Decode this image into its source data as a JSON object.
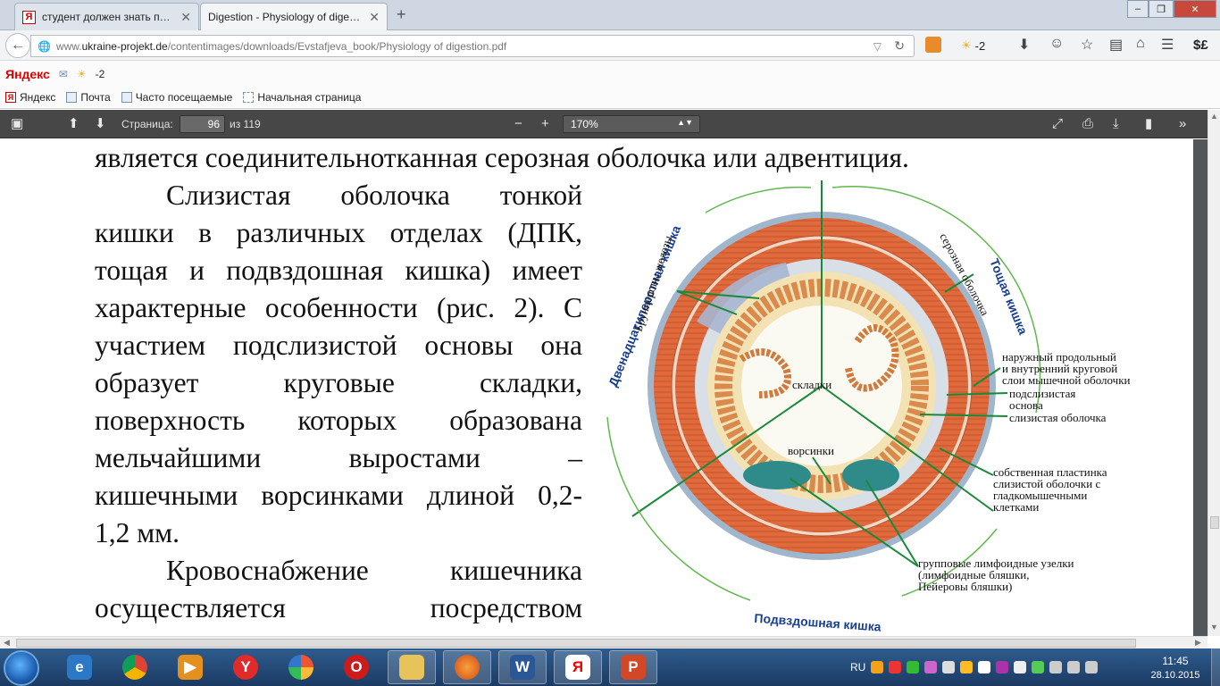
{
  "browser": {
    "tabs": [
      {
        "label": "студент должен знать при...",
        "active": false
      },
      {
        "label": "Digestion - Physiology of diges...",
        "active": true
      }
    ],
    "url_prefix": "www.",
    "url_domain": "ukraine-projekt.de",
    "url_path": "/contentimages/downloads/Evstafjeva_book/Physiology of digestion.pdf",
    "weather_temp": "-2",
    "currency_label": "$£"
  },
  "yandex_bar": {
    "logo": "Яндекс",
    "weather_temp": "-2"
  },
  "bookmarks": [
    "Яндекс",
    "Почта",
    "Часто посещаемые",
    "Начальная страница"
  ],
  "pdf_toolbar": {
    "page_label": "Страница:",
    "page_value": "96",
    "page_total": "из 119",
    "zoom_value": "170%"
  },
  "document": {
    "top_line": "является соединительнотканная серозная оболочка или адвентиция.",
    "lines": [
      "Слизистая оболочка тонкой",
      "кишки в различных отделах (ДПК,",
      "тощая и подвздошная кишка) имеет",
      "характерные особенности (рис. 2). С",
      "участием подслизистой основы она",
      "образует круговые складки,",
      "поверхность которых образована",
      "мельчайшими выростами –",
      "кишечными ворсинками длиной 0,2-",
      "1,2 мм.",
      "Кровоснабжение кишечника",
      "осуществляется посредством"
    ],
    "figure": {
      "label_duodenum": "Двенадцатиперстная кишка",
      "label_jejunum": "Тощая кишка",
      "label_ileum": "Подвздошная кишка",
      "label_brunner": "Бруннеровы железы",
      "label_serosa": "серозная оболочка",
      "label_muscle_1": "наружный продольный",
      "label_muscle_2": "и внутренний круговой",
      "label_muscle_3": "слои мышечной оболочки",
      "label_submucosa_1": "подслизистая",
      "label_submucosa_2": "основа",
      "label_mucosa": "слизистая оболочка",
      "label_lamina_1": "собственная пластинка",
      "label_lamina_2": "слизистой оболочки с",
      "label_lamina_3": "гладкомышечными",
      "label_lamina_4": "клетками",
      "label_folds": "складки",
      "label_villi": "ворсинки",
      "label_peyer_1": "групповые лимфоидные узелки",
      "label_peyer_2": "(лимфоидные бляшки,",
      "label_peyer_3": "Пейеровы бляшки)"
    }
  },
  "taskbar": {
    "lang": "RU",
    "time": "11:45",
    "date": "28.10.2015",
    "apps": [
      "internet-explorer",
      "chrome",
      "media-player",
      "yandex-browser",
      "picasa",
      "opera",
      "file-explorer",
      "firefox",
      "word",
      "yandex",
      "powerpoint"
    ]
  }
}
